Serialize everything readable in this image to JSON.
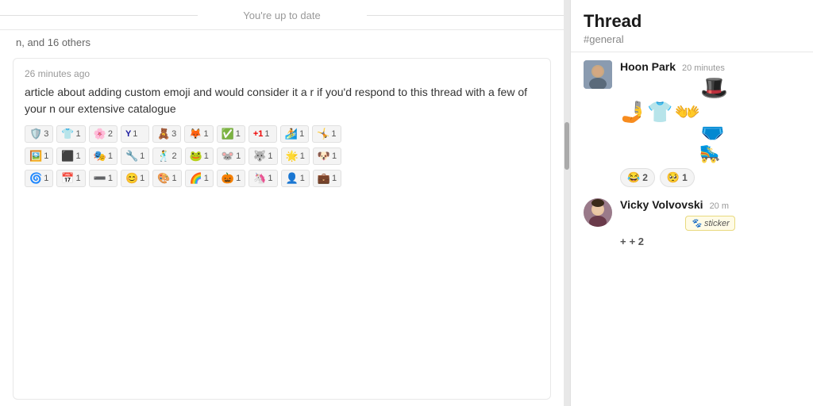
{
  "left": {
    "up_to_date": "You're up to date",
    "others_label": "n, and 16 others",
    "message": {
      "time": "26 minutes ago",
      "text": "article about adding custom emoji and would consider it a r if you'd respond to this thread with a few of your n our extensive catalogue",
      "reactions_row1": [
        {
          "emoji": "🛡️",
          "count": "3"
        },
        {
          "emoji": "👕",
          "count": "1"
        },
        {
          "emoji": "🌸",
          "count": "2"
        },
        {
          "emoji": "Y",
          "count": "1"
        },
        {
          "emoji": "🧸",
          "count": "3"
        },
        {
          "emoji": "🦊",
          "count": "1"
        },
        {
          "emoji": "✅",
          "count": "1"
        },
        {
          "emoji": "+1",
          "count": "1"
        },
        {
          "emoji": "🏄",
          "count": "1"
        },
        {
          "emoji": "🤸",
          "count": "1"
        }
      ],
      "reactions_row2": [
        {
          "emoji": "🖼️",
          "count": "1"
        },
        {
          "emoji": "⬛",
          "count": "1"
        },
        {
          "emoji": "🎭",
          "count": "1"
        },
        {
          "emoji": "🔧",
          "count": "1"
        },
        {
          "emoji": "🕺",
          "count": "2"
        },
        {
          "emoji": "🐸",
          "count": "1"
        },
        {
          "emoji": "🐭",
          "count": "1"
        },
        {
          "emoji": "🐺",
          "count": "1"
        },
        {
          "emoji": "🌟",
          "count": "1"
        },
        {
          "emoji": "🐶",
          "count": "1"
        }
      ],
      "reactions_row3": [
        {
          "emoji": "🌀",
          "count": "1"
        },
        {
          "emoji": "📅",
          "count": "1"
        },
        {
          "emoji": "➖",
          "count": "1"
        },
        {
          "emoji": "😊",
          "count": "1"
        },
        {
          "emoji": "🎨",
          "count": "1"
        },
        {
          "emoji": "🌈",
          "count": "1"
        },
        {
          "emoji": "🎃",
          "count": "1"
        },
        {
          "emoji": "🦄",
          "count": "1"
        },
        {
          "emoji": "👤",
          "count": "1"
        },
        {
          "emoji": "💼",
          "count": "1"
        }
      ]
    }
  },
  "right": {
    "title": "Thread",
    "channel": "#general",
    "messages": [
      {
        "id": "hoon",
        "username": "Hoon Park",
        "timestamp": "20 minutes",
        "avatar_emoji": "😊",
        "emoji_art_line1": "🎩",
        "emoji_art_line2": "🤳👕👐",
        "emoji_art_line3": "🩲",
        "emoji_art_line4": "🛼",
        "reactions": [
          {
            "emoji": "😂",
            "count": "2"
          },
          {
            "emoji": "🥺",
            "count": "1"
          }
        ]
      },
      {
        "id": "vicky",
        "username": "Vicky Volvovski",
        "timestamp": "20 m",
        "avatar_emoji": "👩",
        "sticker_text": "🐾 sticker",
        "plus_count": "+ 2"
      }
    ]
  }
}
